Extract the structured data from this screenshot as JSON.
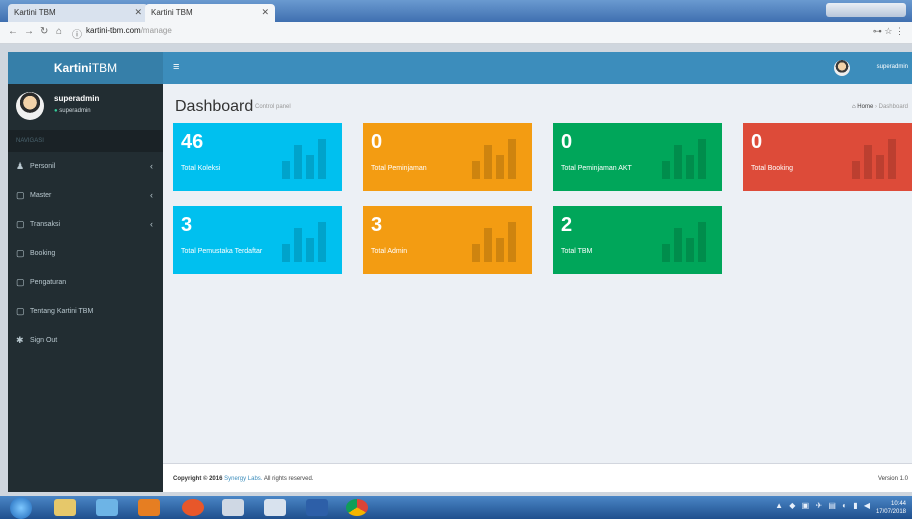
{
  "browser": {
    "tabs": [
      {
        "title": "Kartini TBM",
        "active": false
      },
      {
        "title": "Kartini TBM",
        "active": true
      }
    ],
    "url": "kartini-tbm.com",
    "url_path": "/manage"
  },
  "sidebar": {
    "logo_bold": "Kartini",
    "logo_light": "TBM",
    "user_name": "superadmin",
    "user_status": "superadmin",
    "section_header": "NAVIGASI",
    "items": [
      {
        "label": "Personil",
        "icon": "user-icon",
        "has_children": true
      },
      {
        "label": "Master",
        "icon": "file-icon",
        "has_children": true
      },
      {
        "label": "Transaksi",
        "icon": "file-icon",
        "has_children": true
      },
      {
        "label": "Booking",
        "icon": "file-icon",
        "has_children": false
      },
      {
        "label": "Pengaturan",
        "icon": "file-icon",
        "has_children": false
      },
      {
        "label": "Tentang Kartini TBM",
        "icon": "file-icon",
        "has_children": false
      },
      {
        "label": "Sign Out",
        "icon": "power-icon",
        "has_children": false
      }
    ]
  },
  "topbar": {
    "user_name": "superadmin"
  },
  "header": {
    "title": "Dashboard",
    "subtitle": "Control panel",
    "breadcrumb_home": "Home",
    "breadcrumb_current": "Dashboard"
  },
  "boxes": [
    {
      "value": "46",
      "label": "Total Koleksi",
      "color": "#00c0ef"
    },
    {
      "value": "0",
      "label": "Total Peminjaman",
      "color": "#f39c12"
    },
    {
      "value": "0",
      "label": "Total Peminjaman AKT",
      "color": "#00a65a"
    },
    {
      "value": "0",
      "label": "Total Booking",
      "color": "#dd4b39"
    },
    {
      "value": "3",
      "label": "Total Pemustaka Terdaftar",
      "color": "#00c0ef"
    },
    {
      "value": "3",
      "label": "Total Admin",
      "color": "#f39c12"
    },
    {
      "value": "2",
      "label": "Total TBM",
      "color": "#00a65a"
    }
  ],
  "footer": {
    "copyright": "Copyright © 2016",
    "company": "Synergy Labs.",
    "rights": "All rights reserved.",
    "version": "Version 1.0"
  },
  "taskbar": {
    "time": "10:44",
    "date": "17/07/2018"
  }
}
